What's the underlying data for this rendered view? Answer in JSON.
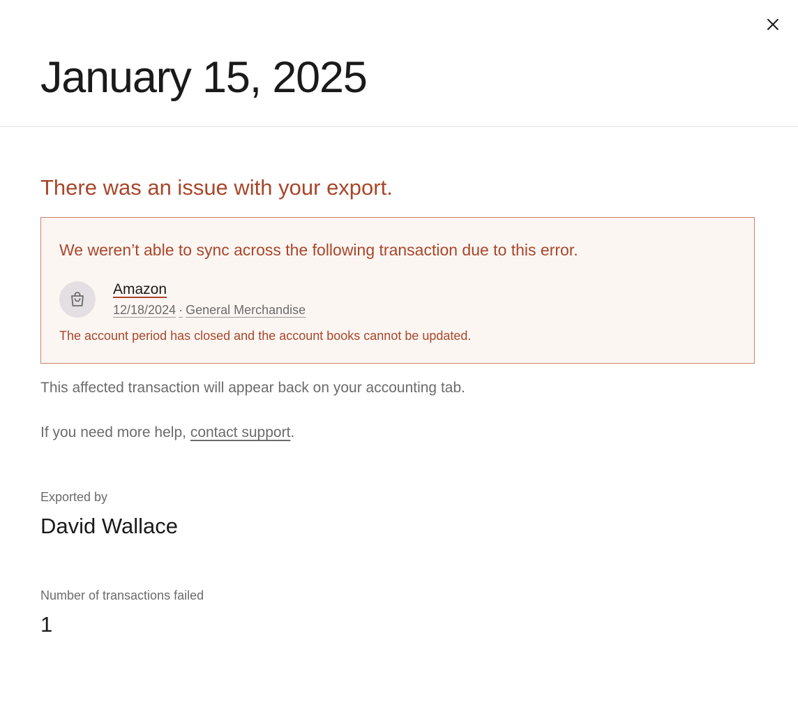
{
  "header": {
    "title": "January 15, 2025",
    "close_icon": "close-icon"
  },
  "error": {
    "heading": "There was an issue with your export.",
    "box_title": "We weren’t able to sync across the following transaction due to this error.",
    "transaction": {
      "icon": "shopping-bag-icon",
      "name": "Amazon",
      "date": "12/18/2024",
      "separator": "·",
      "category": "General Merchandise",
      "error_message": "The account period has closed and the account books cannot be updated."
    }
  },
  "info": {
    "affected_text": "This affected transaction will appear back on your accounting tab.",
    "help_prefix": "If you need more help, ",
    "help_link": "contact support",
    "help_suffix": "."
  },
  "details": {
    "exported_by_label": "Exported by",
    "exported_by_value": "David Wallace",
    "failed_label": "Number of transactions failed",
    "failed_value": "1"
  },
  "colors": {
    "error": "#a8462a",
    "error_bg": "#fcf6f3",
    "error_border": "#c7826a",
    "muted_text": "#6b6b6b"
  }
}
